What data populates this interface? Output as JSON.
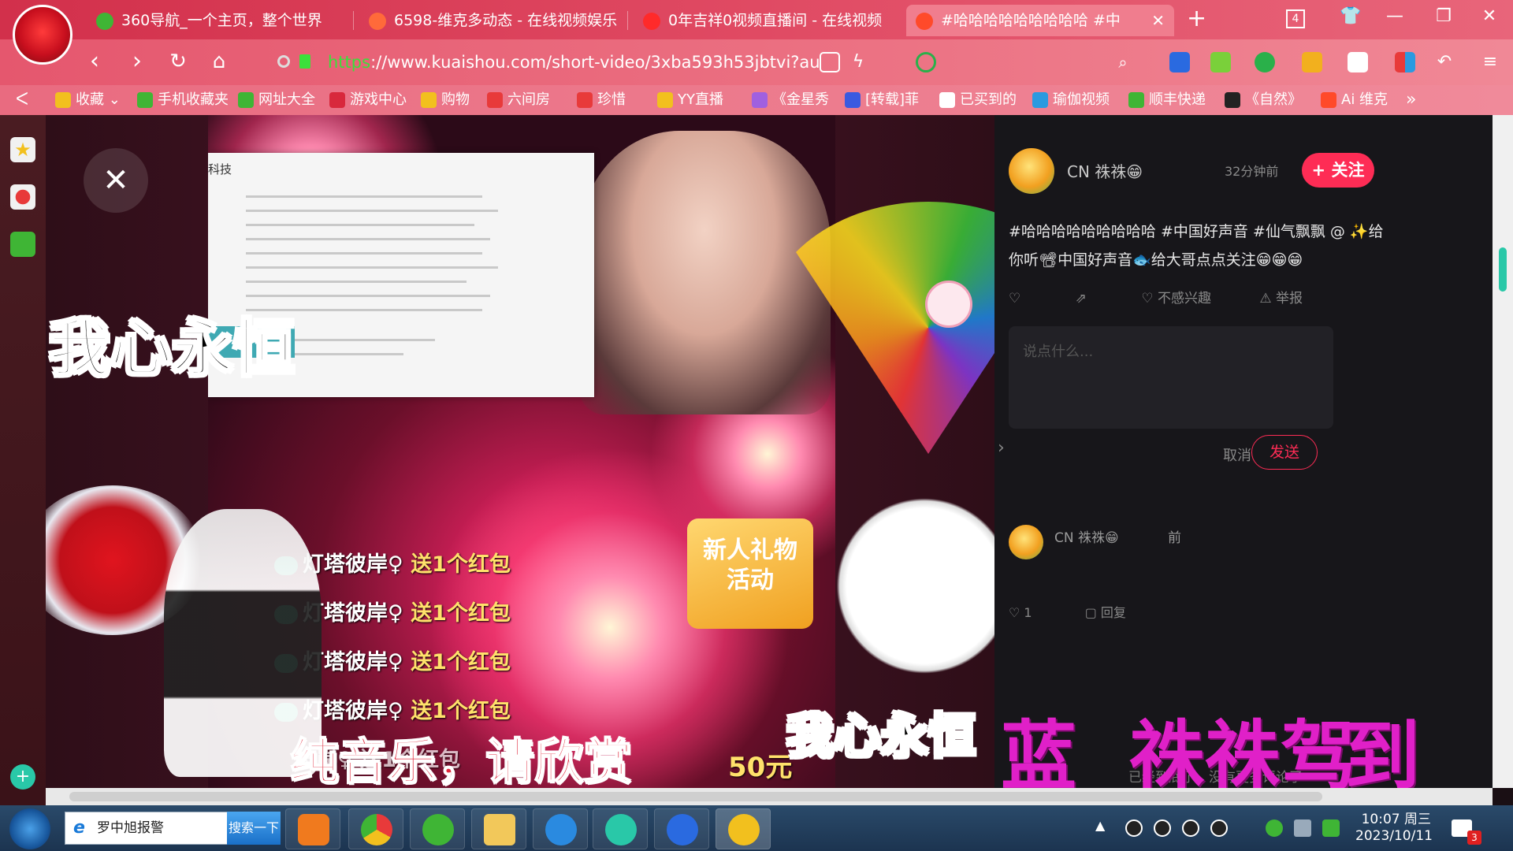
{
  "browser": {
    "tabs": [
      {
        "title": "360导航_一个主页，整个世界",
        "icon_color": "#3fb535"
      },
      {
        "title": "6598-维克多动态 - 在线视频娱乐",
        "icon_color": "#ff6a3a"
      },
      {
        "title": "0年吉祥0视频直播间 - 在线视频",
        "icon_color": "#ff2a2a"
      },
      {
        "title": "#哈哈哈哈哈哈哈哈哈 #中",
        "icon_color": "#ff4a2a"
      }
    ],
    "new_tab": "+",
    "tab_close": "✕",
    "tab_count": "4",
    "url_https": "https",
    "url_rest": "://www.kuaishou.com/short-video/3xba593h53jbtvi?au",
    "bookmarks": [
      {
        "label": "收藏",
        "color": "#f2c01e"
      },
      {
        "label": "手机收藏夹",
        "color": "#3fb535"
      },
      {
        "label": "网址大全",
        "color": "#3fb535"
      },
      {
        "label": "游戏中心",
        "color": "#d8283c"
      },
      {
        "label": "购物",
        "color": "#f2c01e"
      },
      {
        "label": "六间房",
        "color": "#e83a3a"
      },
      {
        "label": "珍惜",
        "color": "#e83a3a"
      },
      {
        "label": "YY直播",
        "color": "#f2c01e"
      },
      {
        "label": "《金星秀",
        "color": "#a060e0"
      },
      {
        "label": "[转载]菲",
        "color": "#3a5ae0"
      },
      {
        "label": "已买到的",
        "color": "#ffffff"
      },
      {
        "label": "瑜伽视频",
        "color": "#2a9ae0"
      },
      {
        "label": "顺丰快递",
        "color": "#3fb535"
      },
      {
        "label": "《自然》",
        "color": "#222222"
      },
      {
        "label": "Ai 维克",
        "color": "#ff4a2a"
      }
    ],
    "bookmarks_more": "»"
  },
  "video": {
    "doc_title": "科技",
    "gift_badge": "新人礼物\n活动",
    "chat": [
      {
        "user": "灯塔彼岸♀",
        "msg": "送1个红包"
      },
      {
        "user": "灯塔彼岸♀",
        "msg": "送1个红包"
      },
      {
        "user": "灯塔彼岸♀",
        "msg": "送1个红包"
      },
      {
        "user": "灯塔彼岸♀",
        "msg": "送1个红包"
      }
    ],
    "chat_partial": "彼岸♀  送1个红包",
    "caption_left": "我心永恒",
    "caption_bottom": "纯音乐，请欣赏",
    "caption_center": "我心永恒",
    "caption_purple": "蓝  祩祩驾",
    "caption_red": "到",
    "promo": "50元"
  },
  "panel": {
    "author": "CN 祩祩😁",
    "time": "32分钟前",
    "follow": "+ 关注",
    "desc": "#哈哈哈哈哈哈哈哈哈 #中国好声音 #仙气飘飘 @ ✨给你听📽中国好声音🐟给大哥点点关注😁😁😁",
    "actions": [
      "♡",
      "⇗",
      "♡ 不感兴趣",
      "⚠ 举报"
    ],
    "comment_placeholder": "说点什么...",
    "cancel": "取消",
    "send": "发送",
    "comment_author": "CN 祩祩😁",
    "comment_time": "前",
    "comment_likes": "♡ 1",
    "comment_reply": "▢ 回复",
    "footer": "已经到底了，没有更多评论了"
  },
  "taskbar": {
    "search_value": "罗中旭报警",
    "search_btn": "搜索一下",
    "time": "10:07 周三",
    "date": "2023/10/11",
    "notify_badge": "3"
  }
}
